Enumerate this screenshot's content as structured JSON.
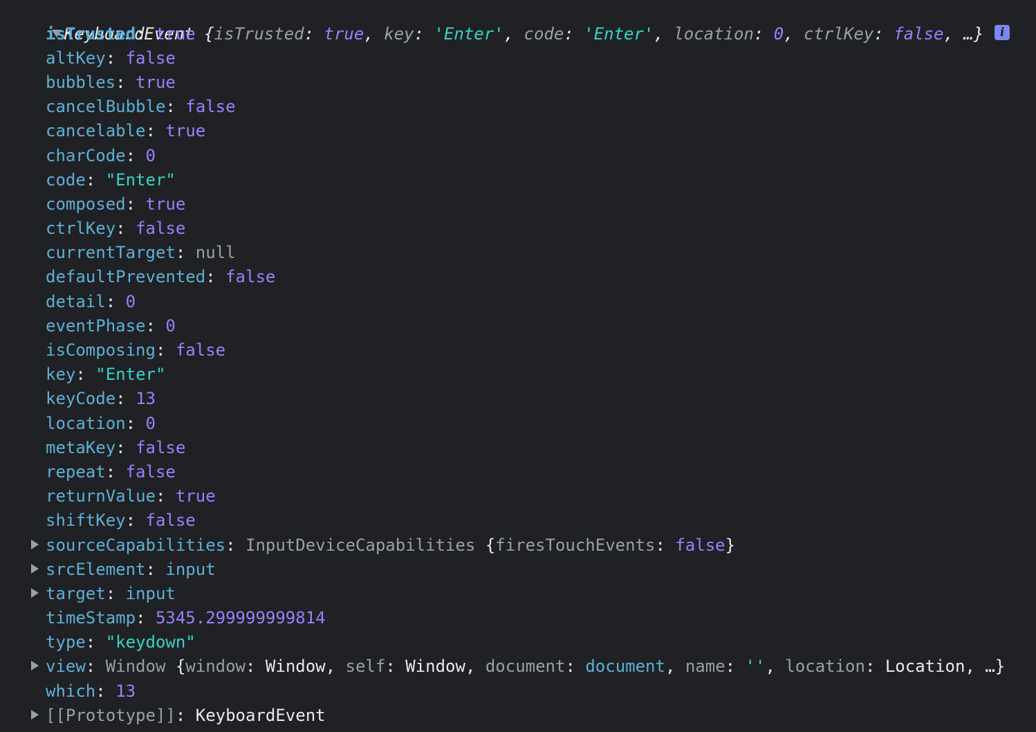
{
  "header": {
    "class_name": "KeyboardEvent",
    "open_brace": " {",
    "preview": [
      {
        "key": "isTrusted",
        "value": "true",
        "kind": "bool"
      },
      {
        "key": "key",
        "value": "'Enter'",
        "kind": "str"
      },
      {
        "key": "code",
        "value": "'Enter'",
        "kind": "str"
      },
      {
        "key": "location",
        "value": "0",
        "kind": "bool"
      },
      {
        "key": "ctrlKey",
        "value": "false",
        "kind": "bool"
      }
    ],
    "ellipsis": "…}",
    "info_icon": "i",
    "info_icon_name": "info-icon"
  },
  "props": {
    "isTrusted": {
      "key": "isTrusted",
      "value": "true"
    },
    "altKey": {
      "key": "altKey",
      "value": "false"
    },
    "bubbles": {
      "key": "bubbles",
      "value": "true"
    },
    "cancelBubble": {
      "key": "cancelBubble",
      "value": "false"
    },
    "cancelable": {
      "key": "cancelable",
      "value": "true"
    },
    "charCode": {
      "key": "charCode",
      "value": "0"
    },
    "code": {
      "key": "code",
      "value": "\"Enter\""
    },
    "composed": {
      "key": "composed",
      "value": "true"
    },
    "ctrlKey": {
      "key": "ctrlKey",
      "value": "false"
    },
    "currentTarget": {
      "key": "currentTarget",
      "value": "null"
    },
    "defaultPrevented": {
      "key": "defaultPrevented",
      "value": "false"
    },
    "detail": {
      "key": "detail",
      "value": "0"
    },
    "eventPhase": {
      "key": "eventPhase",
      "value": "0"
    },
    "isComposing": {
      "key": "isComposing",
      "value": "false"
    },
    "key": {
      "key": "key",
      "value": "\"Enter\""
    },
    "keyCode": {
      "key": "keyCode",
      "value": "13"
    },
    "location": {
      "key": "location",
      "value": "0"
    },
    "metaKey": {
      "key": "metaKey",
      "value": "false"
    },
    "repeat": {
      "key": "repeat",
      "value": "false"
    },
    "returnValue": {
      "key": "returnValue",
      "value": "true"
    },
    "shiftKey": {
      "key": "shiftKey",
      "value": "false"
    },
    "sourceCapabilities": {
      "key": "sourceCapabilities",
      "class_name": "InputDeviceCapabilities",
      "inner_key": "firesTouchEvents",
      "inner_value": "false"
    },
    "srcElement": {
      "key": "srcElement",
      "value": "input"
    },
    "target": {
      "key": "target",
      "value": "input"
    },
    "timeStamp": {
      "key": "timeStamp",
      "value": "5345.299999999814"
    },
    "type": {
      "key": "type",
      "value": "\"keydown\""
    },
    "view": {
      "key": "view",
      "class_name": "Window",
      "p1_key": "window",
      "p1_val": "Window",
      "p2_key": "self",
      "p2_val": "Window",
      "p3_key": "document",
      "p3_val": "document",
      "p4_key": "name",
      "p4_val": "''",
      "p5_key": "location",
      "p5_val": "Location"
    },
    "which": {
      "key": "which",
      "value": "13"
    },
    "prototype": {
      "key": "[[Prototype]]",
      "value": "KeyboardEvent"
    }
  },
  "colors": {
    "background": "#202124",
    "key": "#5db0d7",
    "bool_num": "#9980ff",
    "string": "#35d4c7",
    "dim": "#9aa0a6",
    "info_badge": "#7c87f2"
  }
}
